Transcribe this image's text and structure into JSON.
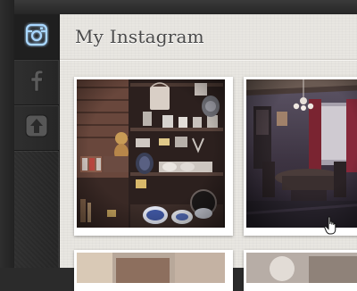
{
  "app": {
    "title": "My Instagram"
  },
  "sidebar": {
    "items": [
      {
        "icon": "instagram-icon",
        "active": true
      },
      {
        "icon": "facebook-icon",
        "active": false
      },
      {
        "icon": "upload-icon",
        "active": false
      }
    ]
  },
  "gallery": {
    "photos": [
      {
        "subject": "kitchen-shelf-photo"
      },
      {
        "subject": "dining-room-photo"
      },
      {
        "subject": "photo-3"
      },
      {
        "subject": "photo-4"
      }
    ]
  },
  "colors": {
    "sidebar_bg": "#2b2b2b",
    "main_bg": "#e8e6e1",
    "title_text": "#4a4a4a",
    "instagram_glow": "#5aa9e6"
  }
}
